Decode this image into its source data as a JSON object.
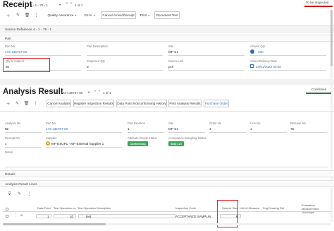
{
  "receipt": {
    "title": "Receipt",
    "record_ref": "4 - 1 - 75 - 1",
    "pager_text": "1 of 1",
    "status": "To be Inspected",
    "toolbar": {
      "quality_assurance": "Quality Assurance",
      "go_to": "Go to",
      "cancel_arrival_receipt": "Cancel Arrival Receipt",
      "print": "Print",
      "document_text": "Document Text"
    },
    "source_reference": "Source Reference 4 - 1 - 75 - 1",
    "part_section": "Part",
    "fields": {
      "part_no_label": "Part No",
      "part_no_value": "173-135797-00",
      "part_description_label": "Part Description",
      "site_label": "Site",
      "site_value": "MF-S1",
      "arrived_qty_label": "Arrived Qty",
      "arrived_qty_value": "100",
      "qty_to_inspect_label": "Qty to Inspect",
      "qty_to_inspect_value": "50",
      "inspected_qty_label": "Inspected Qty",
      "inspected_qty_value": "0",
      "source_unit_label": "Source unit",
      "source_unit_value": "pcs",
      "actual_delivery_date_label": "Actual Delivery Date",
      "actual_delivery_date_value": "24/01/2023 00:00"
    }
  },
  "analysis": {
    "title": "Analysis Result",
    "record_ref": "85 - 173-135797-00",
    "pager_text": "1 of 1",
    "status": "Confirmed",
    "toolbar": {
      "cancel_analysis": "Cancel Analysis",
      "register_inspection_results": "Register Inspection Results",
      "data_point_history": "Data Point Nonconforming History",
      "print_analysis_results": "Print Analysis Results",
      "purchase_order": "Purchase Order"
    },
    "fields": {
      "analysis_no_label": "Analysis No",
      "analysis_no_value": "85",
      "part_no_label": "Part No",
      "part_no_value": "173-135797-00",
      "part_revision_label": "Part Revision",
      "part_revision_value": "1",
      "site_label": "Site",
      "site_value": "MF-S1",
      "order_no_label": "Order No",
      "order_no_value": "4",
      "line_no_label": "Line No",
      "line_no_value": "1",
      "release_no_label": "Release No",
      "release_no_value": "75",
      "receipt_no_label": "Receipt No",
      "receipt_no_value": "1",
      "supplier_label": "Supplier",
      "supplier_value": "MF-ESUP1 - MF-External Supplier 1",
      "attribute_result_status_label": "Attribute Result Status",
      "attribute_result_status_value": "Conforming",
      "acceptance_sampling_status_label": "Acceptance Sampling Status",
      "acceptance_sampling_status_value": "Skip Lot",
      "notes_label": "Notes"
    },
    "details_section": "Details",
    "lines_section": "Analysis Result Lines",
    "table": {
      "headers": {
        "data_point": "Data Point",
        "test_operation_no": "Test Operation no",
        "test_operation_description": "Test Operation Description",
        "inspection_code": "Inspection Code",
        "sample_size": "Sample Size",
        "unit_of_measure": "Unit of Measure",
        "eng_drawing_ref": "Eng Drawing Ref",
        "evaluation_technique": "Evaluation Measurement Technique"
      },
      "rows": [
        {
          "data_point": "1",
          "test_operation_no": "10",
          "test_operation_description": "test",
          "inspection_code": "ACCEPTANCE SAMPLIN...",
          "sample_size": "8"
        }
      ]
    }
  },
  "colors": {
    "accent": "#2a6fb8",
    "highlight_red": "#e52124",
    "status_red": "#d0021b",
    "status_green": "#2e7d32",
    "conforming_green": "#3aa657",
    "skip_lot_green": "#3aa657"
  },
  "icons": {
    "add": "plus-icon",
    "edit": "pencil-icon",
    "delete": "trash-icon",
    "more": "dots-icon",
    "filter": "filter-icon",
    "calendar": "calendar-icon",
    "paperclip": "paperclip-icon"
  }
}
